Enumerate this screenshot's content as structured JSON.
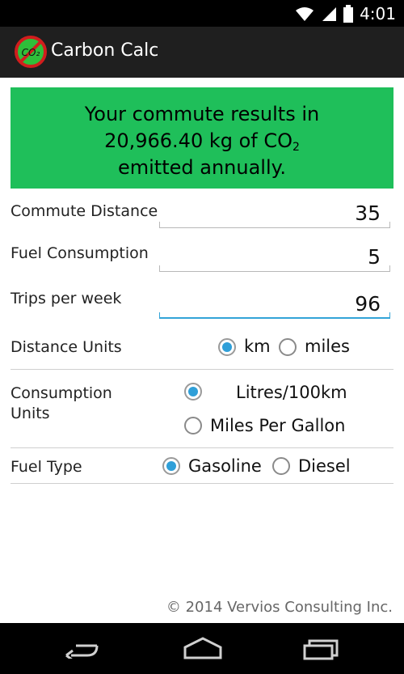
{
  "status": {
    "time": "4:01"
  },
  "app": {
    "title": "Carbon Calc",
    "logo_text": "CO2"
  },
  "result": {
    "line1": "Your commute results in",
    "line2_prefix": "20,966.40 kg of CO",
    "line2_sub": "2",
    "line3": "emitted annually."
  },
  "form": {
    "commute_distance": {
      "label": "Commute Distance",
      "value": "35"
    },
    "fuel_consumption": {
      "label": "Fuel Consumption",
      "value": "5"
    },
    "trips_per_week": {
      "label": "Trips per week",
      "value": "96"
    },
    "distance_units": {
      "label": "Distance Units",
      "options": [
        {
          "label": "km",
          "selected": true
        },
        {
          "label": "miles",
          "selected": false
        }
      ]
    },
    "consumption_units": {
      "label": "Consumption Units",
      "options": [
        {
          "label": "Litres/100km",
          "selected": true
        },
        {
          "label": "Miles Per Gallon",
          "selected": false
        }
      ]
    },
    "fuel_type": {
      "label": "Fuel Type",
      "options": [
        {
          "label": "Gasoline",
          "selected": true
        },
        {
          "label": "Diesel",
          "selected": false
        }
      ]
    }
  },
  "footer": {
    "copyright": "© 2014 Vervios Consulting Inc."
  },
  "colors": {
    "result_bg": "#1fbf5a",
    "accent": "#33a4d8",
    "action_bar": "#1f1f1f"
  },
  "icons": [
    "wifi-icon",
    "signal-icon",
    "battery-icon",
    "back-icon",
    "home-icon",
    "recents-icon"
  ]
}
